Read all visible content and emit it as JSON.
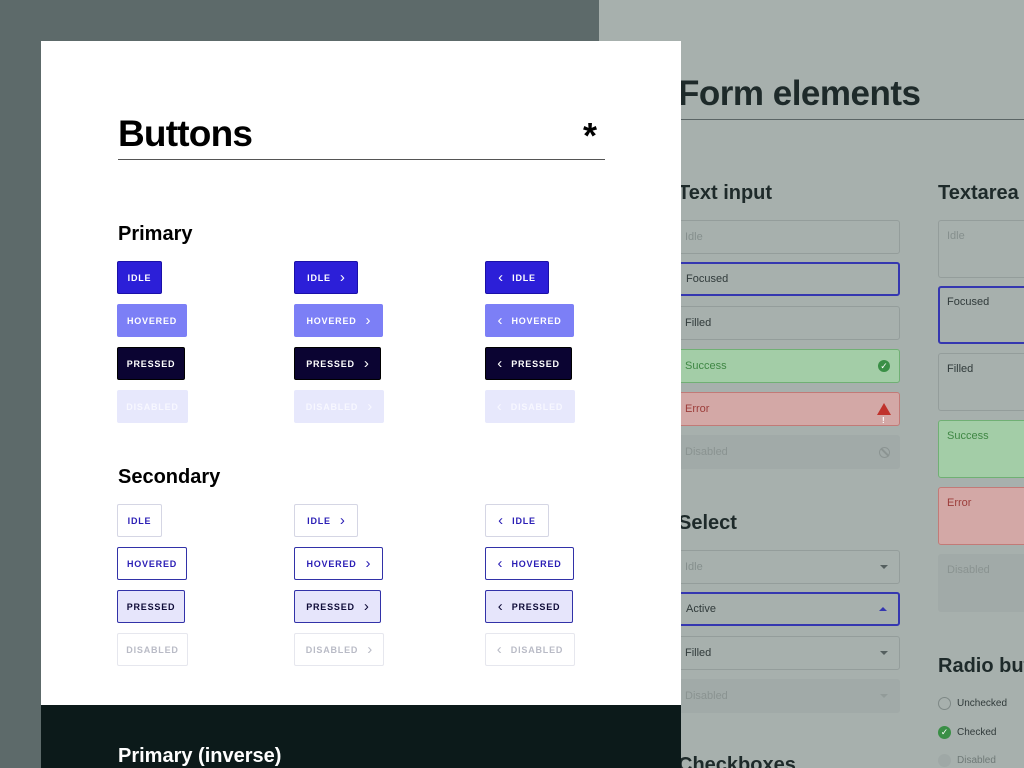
{
  "buttons_card": {
    "title": "Buttons",
    "asterisk": "*",
    "primary_heading": "Primary",
    "secondary_heading": "Secondary",
    "primary_inverse_heading": "Primary (inverse)",
    "chevron_right": "›",
    "chevron_left": "‹",
    "labels": {
      "idle": "IDLE",
      "hovered": "HOVERED",
      "pressed": "PRESSED",
      "disabled": "DISABLED"
    }
  },
  "form_elements": {
    "title": "Form elements",
    "text_input": {
      "heading": "Text input",
      "fields": {
        "idle": "Idle",
        "focused": "Focused",
        "filled": "Filled",
        "success": "Success",
        "error": "Error",
        "disabled": "Disabled"
      }
    },
    "select": {
      "heading": "Select",
      "fields": {
        "idle": "Idle",
        "active": "Active",
        "filled": "Filled",
        "disabled": "Disabled"
      }
    },
    "checkboxes": {
      "heading": "Checkboxes"
    },
    "textarea": {
      "heading": "Textarea",
      "fields": {
        "idle": "Idle",
        "focused": "Focused",
        "filled": "Filled",
        "success": "Success",
        "error": "Error",
        "disabled": "Disabled"
      }
    },
    "radio_buttons": {
      "heading": "Radio buttons",
      "items": {
        "unchecked": "Unchecked",
        "checked": "Checked",
        "disabled": "Disabled"
      }
    }
  },
  "colors": {
    "primary": "#2c1fd8",
    "primary_hover": "#7c7ff6",
    "primary_pressed": "#0b0432",
    "success": "#3a8f46",
    "error": "#c0322c",
    "dark_band": "#0c1a1a"
  }
}
